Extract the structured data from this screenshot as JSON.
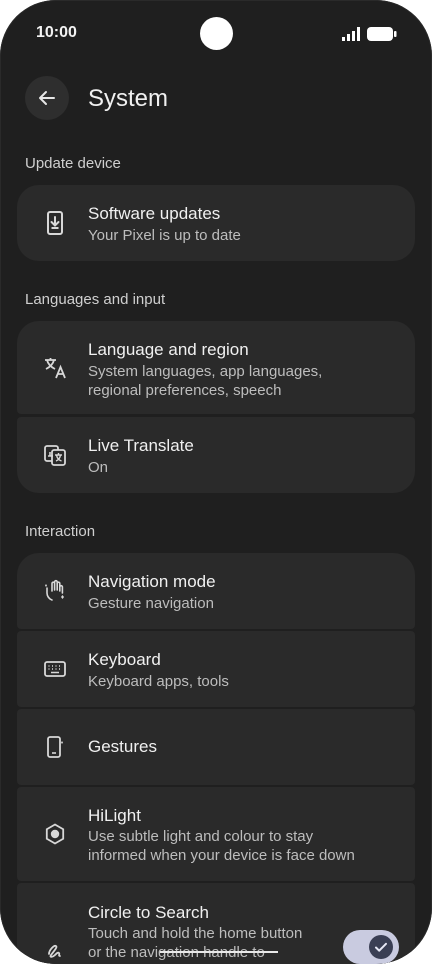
{
  "status": {
    "time": "10:00"
  },
  "header": {
    "title": "System"
  },
  "sections": {
    "update": "Update device",
    "languages": "Languages and input",
    "interaction": "Interaction"
  },
  "items": {
    "software_updates": {
      "title": "Software updates",
      "subtitle": "Your Pixel is up to date"
    },
    "language_region": {
      "title": "Language and region",
      "subtitle_line1": "System languages, app languages,",
      "subtitle_line2": "regional preferences, speech"
    },
    "live_translate": {
      "title": "Live Translate",
      "subtitle": "On"
    },
    "navigation_mode": {
      "title": "Navigation mode",
      "subtitle": "Gesture navigation"
    },
    "keyboard": {
      "title": "Keyboard",
      "subtitle": "Keyboard apps, tools"
    },
    "gestures": {
      "title": "Gestures"
    },
    "hilight": {
      "title": "HiLight",
      "subtitle_line1": "Use subtle light and colour to stay",
      "subtitle_line2": "informed when your device is face down"
    },
    "circle_to_search": {
      "title": "Circle to Search",
      "subtitle_line1": "Touch and hold the home button",
      "subtitle_line2": "or the navigation handle to",
      "toggle_state": "on"
    }
  },
  "colors": {
    "background": "#1f1f1f",
    "card": "#2a2a2a",
    "toggle_track": "#c9cbe0",
    "toggle_knob": "#3a3f54"
  },
  "icons": {
    "back": "arrow-left-icon",
    "software_updates": "phone-download-icon",
    "language_region": "translate-icon",
    "live_translate": "google-translate-icon",
    "navigation_mode": "hand-gesture-icon",
    "keyboard": "keyboard-icon",
    "gestures": "phone-gesture-icon",
    "hilight": "hexagon-light-icon",
    "circle_to_search": "scribble-search-icon"
  }
}
